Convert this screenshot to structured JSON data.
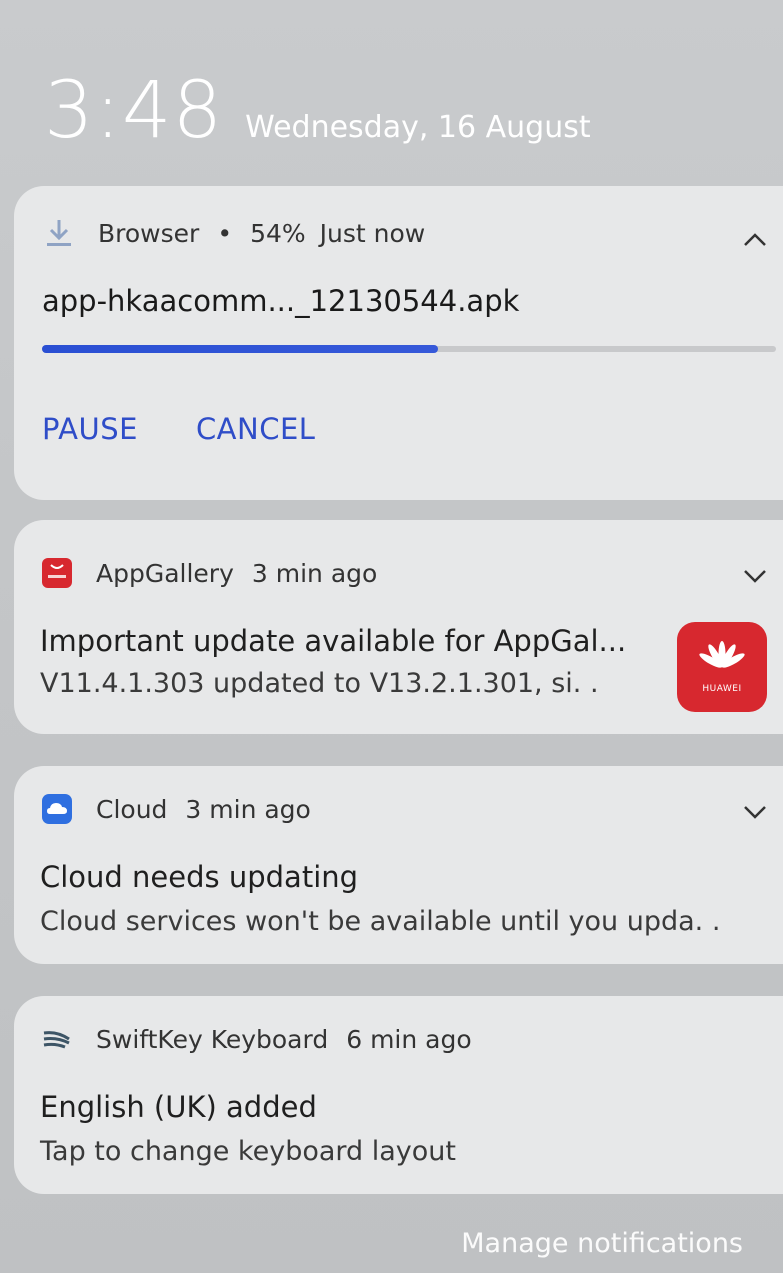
{
  "lockscreen": {
    "time": "3:48",
    "date": "Wednesday, 16 August"
  },
  "notifications": [
    {
      "app": "Browser",
      "separator": "•",
      "percent_text": "54%",
      "time": "Just now",
      "file_name": "app-hkaacomm..._12130544.apk",
      "progress": 0.54,
      "actions": [
        "PAUSE",
        "CANCEL"
      ],
      "icon": "download-icon",
      "expanded": true
    },
    {
      "app": "AppGallery",
      "time": "3 min ago",
      "title": "Important update available for AppGal...",
      "body": "V11.4.1.303 updated to V13.2.1.301, si. .",
      "icon": "appgallery-icon",
      "large_icon_brand": "HUAWEI",
      "expanded": false
    },
    {
      "app": "Cloud",
      "time": "3 min ago",
      "title": "Cloud needs updating",
      "body": "Cloud services won't be available until you upda. .",
      "icon": "cloud-icon",
      "expanded": false
    },
    {
      "app": "SwiftKey Keyboard",
      "time": "6 min ago",
      "title": "English (UK) added",
      "body": "Tap to change keyboard layout",
      "icon": "swiftkey-icon"
    }
  ],
  "footer": {
    "manage_label": "Manage notifications"
  },
  "colors": {
    "accent_blue": "#2f4dc8",
    "huawei_red": "#d7282f",
    "cloud_blue": "#2f6fe0",
    "card_bg": "#e7e8e9"
  }
}
